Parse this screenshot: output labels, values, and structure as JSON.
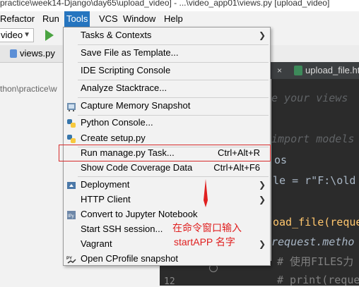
{
  "window_title": "practice\\week14-Django\\day65\\upload_video] - ...\\video_app01\\views.py [upload_video]",
  "menubar": {
    "items": [
      "Refactor",
      "Run",
      "Tools",
      "VCS",
      "Window",
      "Help"
    ],
    "active": "Tools"
  },
  "toolbar": {
    "config_value": "video"
  },
  "file_tabs": {
    "views": "views.py"
  },
  "path_fragment": "thon\\practice\\w",
  "editor": {
    "tab_upload": "upload_file.ht",
    "line_number": "12",
    "code_lines": [
      "e your views",
      "import models",
      "os",
      "le = r\"F:\\old",
      "oad_file(reque",
      "request.metho",
      "# 使用FILES力",
      "# print(reque"
    ]
  },
  "menu": {
    "items": [
      {
        "label": "Tasks & Contexts",
        "submenu": true
      },
      {
        "label": "Save File as Template..."
      },
      {
        "label": "IDE Scripting Console"
      },
      {
        "label": "Analyze Stacktrace..."
      },
      {
        "label": "Capture Memory Snapshot",
        "icon": "memory-icon"
      },
      {
        "label": "Python Console...",
        "icon": "python-icon"
      },
      {
        "label": "Create setup.py"
      },
      {
        "label": "Run manage.py Task...",
        "shortcut": "Ctrl+Alt+R"
      },
      {
        "label": "Show Code Coverage Data",
        "shortcut": "Ctrl+Alt+F6"
      },
      {
        "label": "Deployment",
        "submenu": true,
        "icon": "deployment-icon"
      },
      {
        "label": "HTTP Client",
        "submenu": true
      },
      {
        "label": "Convert to Jupyter Notebook",
        "icon": "jupyter-icon"
      },
      {
        "label": "Start SSH session..."
      },
      {
        "label": "Vagrant",
        "submenu": true
      },
      {
        "label": "Open CProfile snapshot",
        "icon": "cprofile-icon"
      }
    ]
  },
  "annotation": {
    "line1": "在命令窗口输入",
    "line2": "startAPP 名字"
  },
  "colors": {
    "menu_active": "#2675bf",
    "highlight_border": "#d62b2b",
    "annotation_red": "#e02020",
    "editor_bg": "#2b2b2b"
  }
}
